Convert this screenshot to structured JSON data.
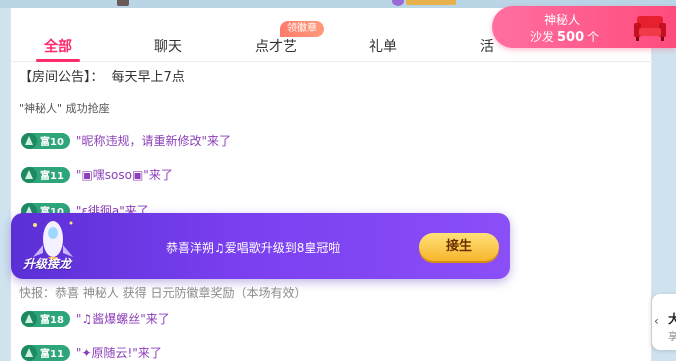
{
  "tabs": [
    {
      "label": "全部"
    },
    {
      "label": "聊天"
    },
    {
      "label": "点才艺"
    },
    {
      "label": "礼单"
    },
    {
      "label": "活"
    }
  ],
  "tab_badge": "领徽章",
  "announcement": {
    "prefix": "【房间公告】：",
    "text": "每天早上7点"
  },
  "seat_message": "\"神秘人\" 成功抢座",
  "messages": [
    {
      "level": "富10",
      "text": "\"昵称违规，请重新修改\"来了"
    },
    {
      "level": "富11",
      "text": "\"▣嘿soso▣\"来了"
    },
    {
      "level": "富10",
      "text": "\"ε徘徊a\"来了"
    },
    {
      "level": "富18",
      "text": "\"♫酱爆螺丝\"来了"
    },
    {
      "level": "富11",
      "text": "\"✦原随云!\"来了"
    }
  ],
  "notice_line": "快报：恭喜 神秘人 获得 日元防徽章奖励（本场有效）",
  "sofa": {
    "title": "神秘人",
    "label": "沙发",
    "count": "500",
    "unit": "个"
  },
  "banner": {
    "tag": "升级接龙",
    "text": "恭喜洋朔♫爱唱歌升级到8皇冠啦",
    "button": "接生"
  },
  "mini_card": {
    "big": "大",
    "small": "享"
  }
}
